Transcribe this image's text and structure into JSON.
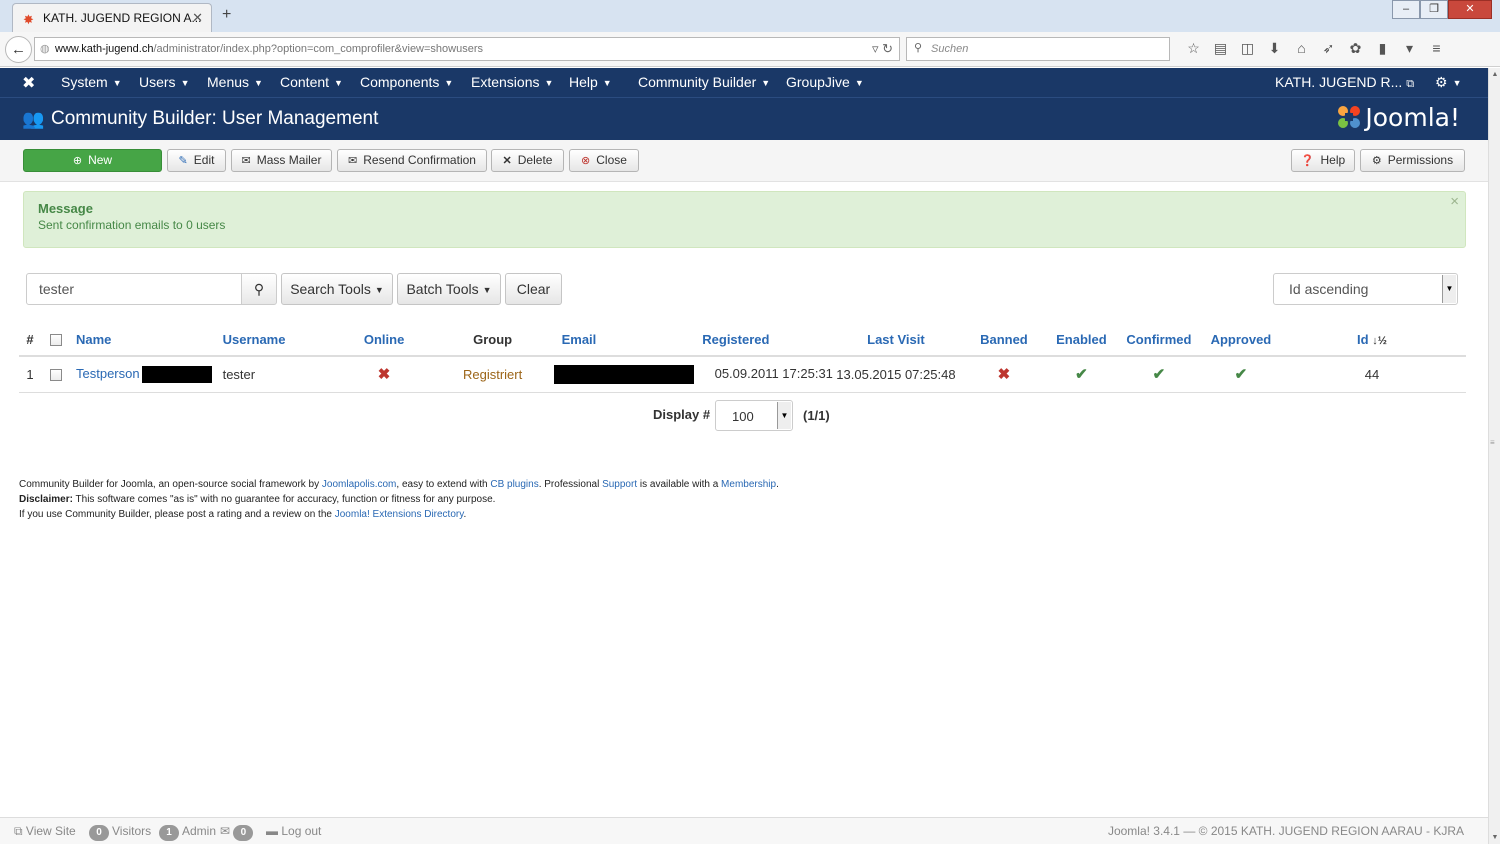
{
  "browser": {
    "tab_title": "KATH. JUGEND REGION A...",
    "url_domain": "www.kath-jugend.ch",
    "url_path": "/administrator/index.php?option=com_comprofiler&view=showusers",
    "search_placeholder": "Suchen"
  },
  "menu": {
    "items": [
      "System",
      "Users",
      "Menus",
      "Content",
      "Components",
      "Extensions",
      "Help",
      "Community Builder",
      "GroupJive"
    ],
    "site_name": "KATH. JUGEND R..."
  },
  "header": {
    "title": "Community Builder: User Management",
    "brand": "Joomla!"
  },
  "toolbar": {
    "new": "New",
    "edit": "Edit",
    "mass_mailer": "Mass Mailer",
    "resend": "Resend Confirmation",
    "delete": "Delete",
    "close": "Close",
    "help": "Help",
    "permissions": "Permissions"
  },
  "message": {
    "heading": "Message",
    "text": "Sent confirmation emails to 0 users"
  },
  "filters": {
    "search_value": "tester",
    "search_tools": "Search Tools",
    "batch_tools": "Batch Tools",
    "clear": "Clear",
    "ordering": "Id ascending"
  },
  "table": {
    "headers": {
      "num": "#",
      "name": "Name",
      "username": "Username",
      "online": "Online",
      "group": "Group",
      "email": "Email",
      "registered": "Registered",
      "last_visit": "Last Visit",
      "banned": "Banned",
      "enabled": "Enabled",
      "confirmed": "Confirmed",
      "approved": "Approved",
      "id": "Id"
    },
    "rows": [
      {
        "num": "1",
        "name": "Testperson",
        "username": "tester",
        "online": false,
        "group": "Registriert",
        "registered": "05.09.2011 17:25:31",
        "last_visit": "13.05.2015 07:25:48",
        "banned": false,
        "enabled": true,
        "confirmed": true,
        "approved": true,
        "id": "44"
      }
    ]
  },
  "pagination": {
    "display_label": "Display #",
    "limit": "100",
    "pages": "(1/1)"
  },
  "cb_footer": {
    "l1_a": "Community Builder for Joomla, an open-source social framework by ",
    "l1_link1": "Joomlapolis.com",
    "l1_b": ", easy to extend with ",
    "l1_link2": "CB plugins",
    "l1_c": ". Professional ",
    "l1_link3": "Support",
    "l1_d": " is available with a ",
    "l1_link4": "Membership",
    "l1_e": ".",
    "l2_bold": "Disclaimer:",
    "l2_text": " This software comes \"as is\" with no guarantee for accuracy, function or fitness for any purpose.",
    "l3_a": "If you use Community Builder, please post a rating and a review on the ",
    "l3_link": "Joomla! Extensions Directory",
    "l3_b": "."
  },
  "status": {
    "view_site": "View Site",
    "visitors_count": "0",
    "visitors": "Visitors",
    "admin_count": "1",
    "admin": "Admin",
    "messages_count": "0",
    "logout": "Log out",
    "copyright": "Joomla! 3.4.1 — © 2015 KATH. JUGEND REGION AARAU - KJRA"
  },
  "colors": {
    "nav_blue": "#1a3867",
    "link_blue": "#2a69b4",
    "success_bg": "#dff0d8",
    "new_button": "#46a546"
  }
}
